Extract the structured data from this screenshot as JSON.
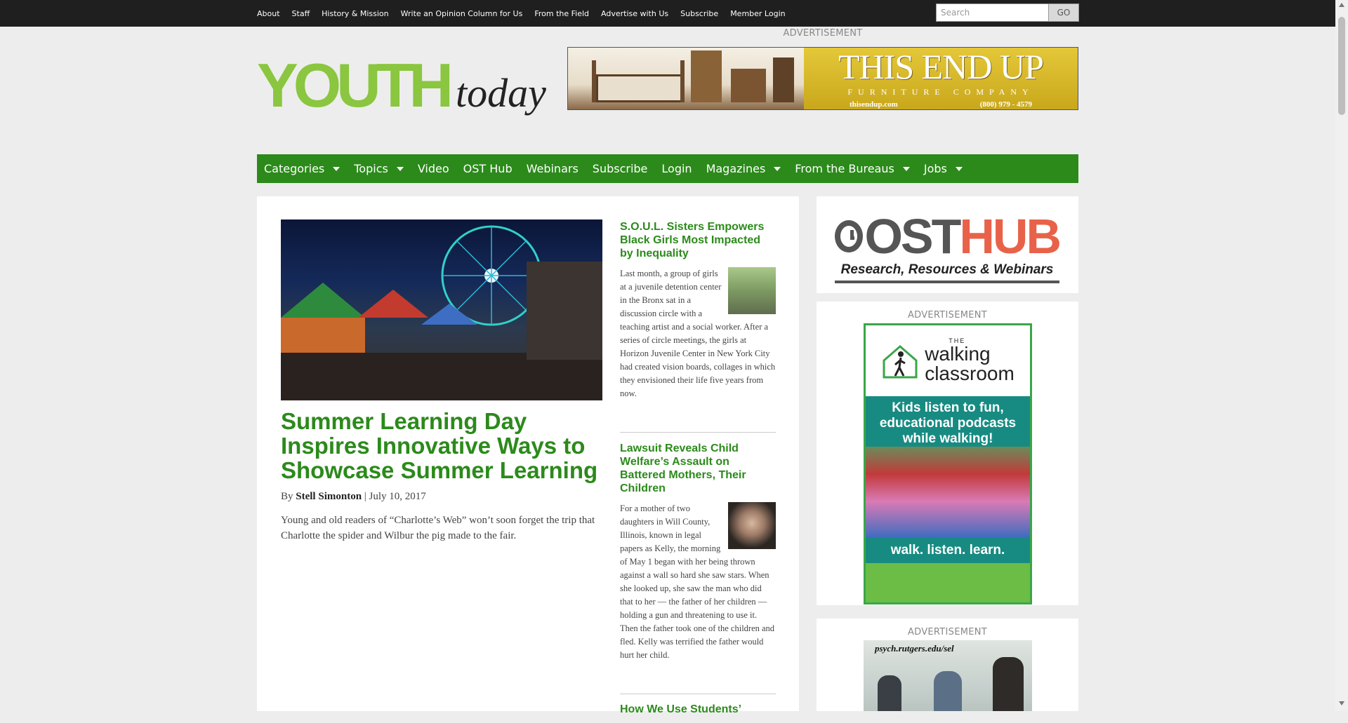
{
  "top_nav": {
    "links": [
      "About",
      "Staff",
      "History & Mission",
      "Write an Opinion Column for Us",
      "From the Field",
      "Advertise with Us",
      "Subscribe",
      "Member Login"
    ],
    "search_placeholder": "Search",
    "search_button": "GO"
  },
  "header": {
    "ad_label": "ADVERTISEMENT",
    "logo_word1": "YOUTH",
    "logo_word2": "today",
    "banner": {
      "brand": "THIS END UP",
      "subtitle": "FURNITURE COMPANY",
      "website": "thisendup.com",
      "phone": "(800) 979 - 4579"
    }
  },
  "main_nav": {
    "items": [
      {
        "label": "Categories",
        "dropdown": true
      },
      {
        "label": "Topics",
        "dropdown": true
      },
      {
        "label": "Video",
        "dropdown": false
      },
      {
        "label": "OST Hub",
        "dropdown": false
      },
      {
        "label": "Webinars",
        "dropdown": false
      },
      {
        "label": "Subscribe",
        "dropdown": false
      },
      {
        "label": "Login",
        "dropdown": false
      },
      {
        "label": "Magazines",
        "dropdown": true
      },
      {
        "label": "From the Bureaus",
        "dropdown": true
      },
      {
        "label": "Jobs",
        "dropdown": true
      }
    ]
  },
  "feature": {
    "title": "Summer Learning Day Inspires Innovative Ways to Showcase Summer Learning",
    "byline_prefix": "By",
    "author": "Stell Simonton",
    "date": "| July 10, 2017",
    "excerpt": "Young and old readers of “Charlotte’s Web” won’t soon forget the trip that Charlotte the spider and Wilbur the pig made to the fair."
  },
  "side_stories": [
    {
      "title": "S.O.U.L. Sisters Empowers Black Girls Most Impacted by Inequality",
      "excerpt": "Last month, a group of girls at a juvenile detention center in the Bronx sat in a discussion circle with a teaching artist and a social worker. After a series of circle meetings, the girls at Horizon Juvenile Center in New York City had created vision boards, collages in which they envisioned their life five years from now."
    },
    {
      "title": "Lawsuit Reveals Child Welfare’s Assault on Battered Mothers, Their Children",
      "excerpt": "For a mother of two daughters in Will County, Illinois, known in legal papers as Kelly, the morning of May 1 began with her being thrown against a wall so hard she saw stars. When she looked up, she saw the man who did that to her — the father of her children — holding a gun and threatening to use it. Then the father took one of the children and fled. Kelly was terrified the father would hurt her child."
    },
    {
      "title": "How We Use Students’"
    }
  ],
  "sidebar": {
    "osthub": {
      "word1": "OST",
      "word2": "HUB",
      "tagline": "Research, Resources & Webinars"
    },
    "ad_label": "ADVERTISEMENT",
    "walking": {
      "brand_small": "THE",
      "brand_line1": "walking",
      "brand_line2": "classroom",
      "headline": "Kids listen to fun, educational podcasts while walking!",
      "footer": "walk. listen. learn."
    },
    "rutgers": {
      "url": "psych.rutgers.edu/sel"
    }
  },
  "colors": {
    "brand_green": "#2c8a1b",
    "logo_green": "#8ac63f",
    "ost_orange": "#e8624a",
    "top_bar": "#1f1f1f"
  }
}
